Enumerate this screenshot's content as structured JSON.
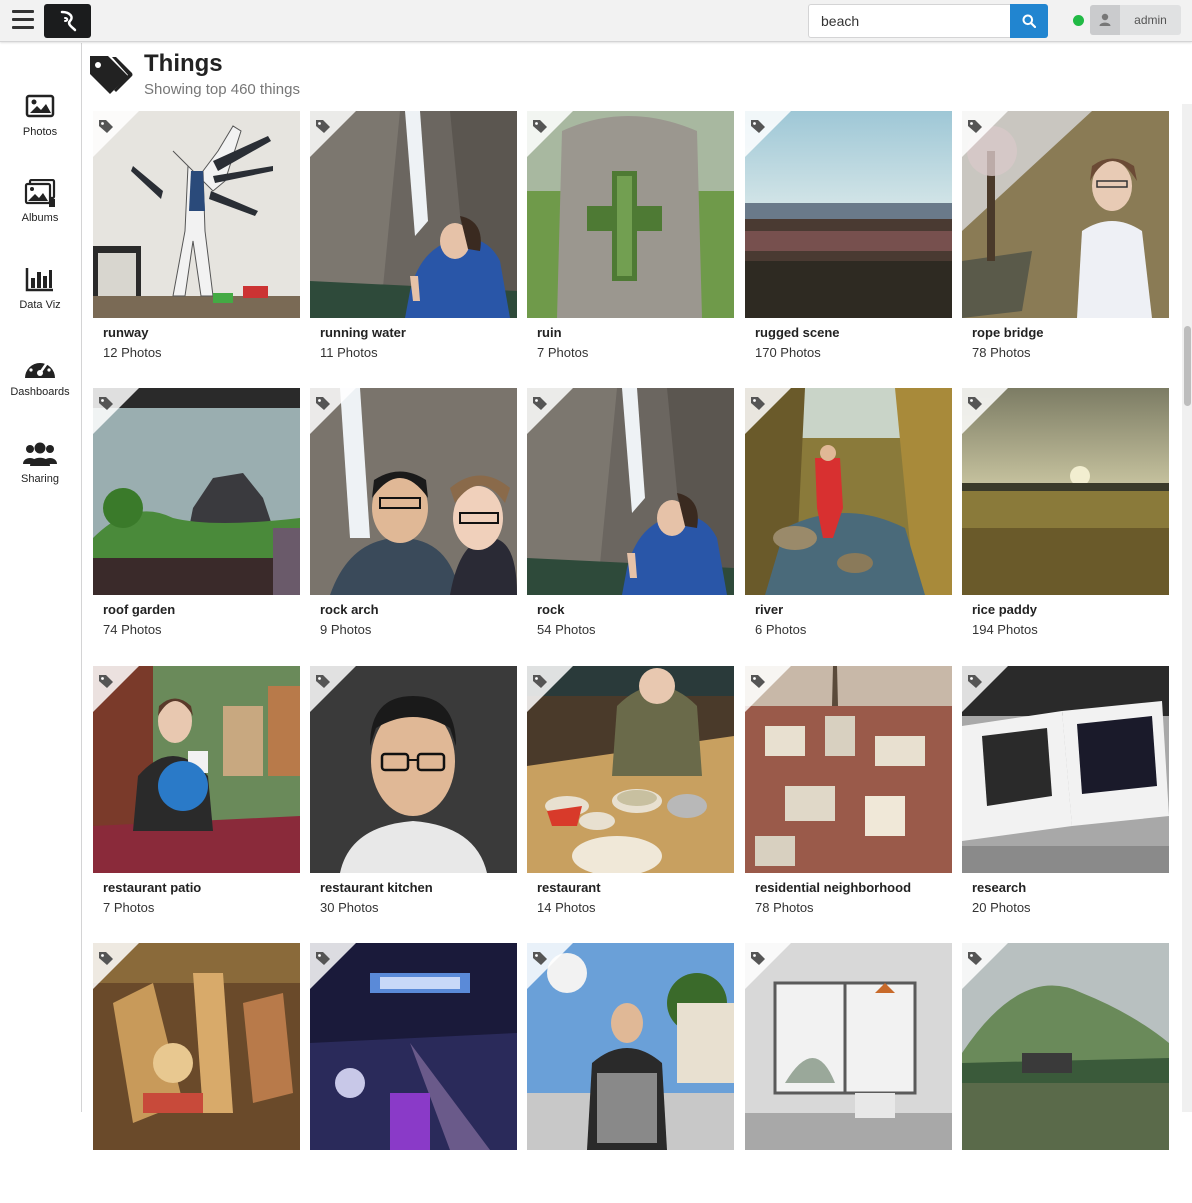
{
  "topbar": {
    "search_value": "beach",
    "user_label": "admin",
    "status_color": "#21ba45",
    "accent_color": "#2185d0"
  },
  "sidebar": {
    "items": [
      {
        "label": "Photos",
        "icon": "photo-icon"
      },
      {
        "label": "Albums",
        "icon": "albums-icon"
      },
      {
        "label": "Data Viz",
        "icon": "bar-chart-icon"
      },
      {
        "label": "Dashboards",
        "icon": "dashboard-icon"
      },
      {
        "label": "Sharing",
        "icon": "users-icon"
      }
    ]
  },
  "header": {
    "title": "Things",
    "subtitle": "Showing top 460 things",
    "icon": "tags-icon"
  },
  "things": [
    {
      "name": "runway",
      "count": "12 Photos"
    },
    {
      "name": "running water",
      "count": "11 Photos"
    },
    {
      "name": "ruin",
      "count": "7 Photos"
    },
    {
      "name": "rugged scene",
      "count": "170 Photos"
    },
    {
      "name": "rope bridge",
      "count": "78 Photos"
    },
    {
      "name": "roof garden",
      "count": "74 Photos"
    },
    {
      "name": "rock arch",
      "count": "9 Photos"
    },
    {
      "name": "rock",
      "count": "54 Photos"
    },
    {
      "name": "river",
      "count": "6 Photos"
    },
    {
      "name": "rice paddy",
      "count": "194 Photos"
    },
    {
      "name": "restaurant patio",
      "count": "7 Photos"
    },
    {
      "name": "restaurant kitchen",
      "count": "30 Photos"
    },
    {
      "name": "restaurant",
      "count": "14 Photos"
    },
    {
      "name": "residential neighborhood",
      "count": "78 Photos"
    },
    {
      "name": "research",
      "count": "20 Photos"
    }
  ]
}
